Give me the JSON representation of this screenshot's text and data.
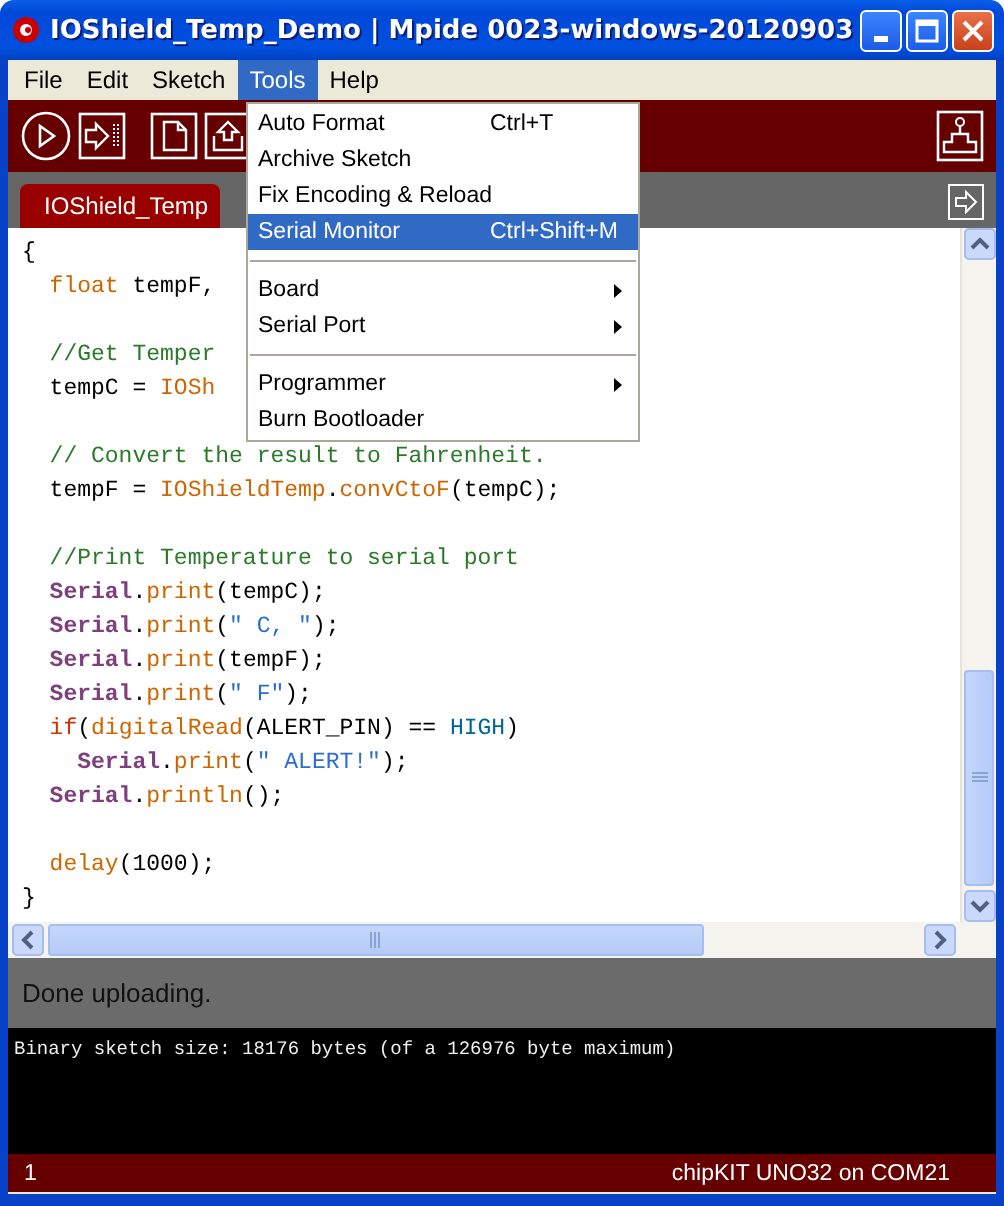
{
  "window": {
    "title": "IOShield_Temp_Demo | Mpide 0023-windows-20120903"
  },
  "menubar": [
    {
      "label": "File",
      "selected": false
    },
    {
      "label": "Edit",
      "selected": false
    },
    {
      "label": "Sketch",
      "selected": false
    },
    {
      "label": "Tools",
      "selected": true
    },
    {
      "label": "Help",
      "selected": false
    }
  ],
  "tools_menu": {
    "items": [
      {
        "kind": "item",
        "label": "Auto Format",
        "shortcut": "Ctrl+T",
        "submenu": false,
        "selected": false
      },
      {
        "kind": "item",
        "label": "Archive Sketch",
        "submenu": false,
        "selected": false
      },
      {
        "kind": "item",
        "label": "Fix Encoding & Reload",
        "submenu": false,
        "selected": false
      },
      {
        "kind": "item",
        "label": "Serial Monitor",
        "shortcut": "Ctrl+Shift+M",
        "submenu": false,
        "selected": true
      },
      {
        "kind": "separator"
      },
      {
        "kind": "item",
        "label": "Board",
        "submenu": true,
        "selected": false
      },
      {
        "kind": "item",
        "label": "Serial Port",
        "submenu": true,
        "selected": false
      },
      {
        "kind": "separator"
      },
      {
        "kind": "item",
        "label": "Programmer",
        "submenu": true,
        "selected": false
      },
      {
        "kind": "item",
        "label": "Burn Bootloader",
        "submenu": false,
        "selected": false
      }
    ]
  },
  "tabs": [
    {
      "label": "IOShield_Temp",
      "selected": true
    }
  ],
  "code": [
    {
      "kind": "code",
      "tokens": [
        {
          "kind": "plain",
          "text": "{"
        }
      ]
    },
    {
      "kind": "code",
      "tokens": [
        {
          "kind": "type",
          "text": "  float"
        },
        {
          "kind": "plain",
          "text": " tempF,"
        }
      ]
    },
    {
      "kind": "blank"
    },
    {
      "kind": "code",
      "tokens": [
        {
          "kind": "comment",
          "text": "  //Get Temper"
        }
      ]
    },
    {
      "kind": "code",
      "tokens": [
        {
          "kind": "plain",
          "text": "  tempC = "
        },
        {
          "kind": "function",
          "text": "IOSh"
        }
      ]
    },
    {
      "kind": "blank"
    },
    {
      "kind": "code",
      "tokens": [
        {
          "kind": "comment",
          "text": "  // Convert the result to Fahrenheit."
        }
      ]
    },
    {
      "kind": "code",
      "tokens": [
        {
          "kind": "plain",
          "text": "  tempF = "
        },
        {
          "kind": "function",
          "text": "IOShieldTemp"
        },
        {
          "kind": "plain",
          "text": "."
        },
        {
          "kind": "function",
          "text": "convCtoF"
        },
        {
          "kind": "plain",
          "text": "(tempC);"
        }
      ]
    },
    {
      "kind": "blank"
    },
    {
      "kind": "code",
      "tokens": [
        {
          "kind": "comment",
          "text": "  //Print Temperature to serial port"
        }
      ]
    },
    {
      "kind": "code",
      "tokens": [
        {
          "kind": "class",
          "text": "  Serial"
        },
        {
          "kind": "plain",
          "text": "."
        },
        {
          "kind": "function",
          "text": "print"
        },
        {
          "kind": "plain",
          "text": "(tempC);"
        }
      ]
    },
    {
      "kind": "code",
      "tokens": [
        {
          "kind": "class",
          "text": "  Serial"
        },
        {
          "kind": "plain",
          "text": "."
        },
        {
          "kind": "function",
          "text": "print"
        },
        {
          "kind": "plain",
          "text": "("
        },
        {
          "kind": "string",
          "text": "\" C, \""
        },
        {
          "kind": "plain",
          "text": ");"
        }
      ]
    },
    {
      "kind": "code",
      "tokens": [
        {
          "kind": "class",
          "text": "  Serial"
        },
        {
          "kind": "plain",
          "text": "."
        },
        {
          "kind": "function",
          "text": "print"
        },
        {
          "kind": "plain",
          "text": "(tempF);"
        }
      ]
    },
    {
      "kind": "code",
      "tokens": [
        {
          "kind": "class",
          "text": "  Serial"
        },
        {
          "kind": "plain",
          "text": "."
        },
        {
          "kind": "function",
          "text": "print"
        },
        {
          "kind": "plain",
          "text": "("
        },
        {
          "kind": "string",
          "text": "\" F\""
        },
        {
          "kind": "plain",
          "text": ");"
        }
      ]
    },
    {
      "kind": "code",
      "tokens": [
        {
          "kind": "keyword",
          "text": "  if"
        },
        {
          "kind": "plain",
          "text": "("
        },
        {
          "kind": "function",
          "text": "digitalRead"
        },
        {
          "kind": "plain",
          "text": "(ALERT_PIN) == "
        },
        {
          "kind": "constant",
          "text": "HIGH"
        },
        {
          "kind": "plain",
          "text": ")"
        }
      ]
    },
    {
      "kind": "code",
      "tokens": [
        {
          "kind": "class",
          "text": "    Serial"
        },
        {
          "kind": "plain",
          "text": "."
        },
        {
          "kind": "function",
          "text": "print"
        },
        {
          "kind": "plain",
          "text": "("
        },
        {
          "kind": "string",
          "text": "\" ALERT!\""
        },
        {
          "kind": "plain",
          "text": ");"
        }
      ]
    },
    {
      "kind": "code",
      "tokens": [
        {
          "kind": "class",
          "text": "  Serial"
        },
        {
          "kind": "plain",
          "text": "."
        },
        {
          "kind": "function",
          "text": "println"
        },
        {
          "kind": "plain",
          "text": "();"
        }
      ]
    },
    {
      "kind": "blank"
    },
    {
      "kind": "code",
      "tokens": [
        {
          "kind": "function",
          "text": "  delay"
        },
        {
          "kind": "plain",
          "text": "(1000);"
        }
      ]
    },
    {
      "kind": "code",
      "tokens": [
        {
          "kind": "plain",
          "text": "}"
        }
      ]
    }
  ],
  "status": "Done uploading.",
  "console": [
    "Binary sketch size: 18176 bytes (of a 126976 byte maximum)"
  ],
  "footer": {
    "line": "1",
    "board": "chipKIT UNO32 on COM21"
  }
}
